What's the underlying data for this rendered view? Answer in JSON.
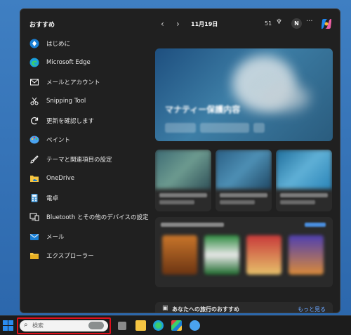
{
  "start_panel": {
    "recommended_title": "おすすめ",
    "items": [
      {
        "label": "はじめに",
        "icon": "tips-icon",
        "color": "#1a7fd4"
      },
      {
        "label": "Microsoft Edge",
        "icon": "edge-icon",
        "color": "#1aa0e0"
      },
      {
        "label": "メールとアカウント",
        "icon": "mail-account-icon",
        "color": "#ffffff"
      },
      {
        "label": "Snipping Tool",
        "icon": "snipping-tool-icon",
        "color": "#ffffff"
      },
      {
        "label": "更新を確認します",
        "icon": "refresh-icon",
        "color": "#ffffff"
      },
      {
        "label": "ペイント",
        "icon": "paint-icon",
        "color": "#4aa3f0"
      },
      {
        "label": "テーマと関連項目の設定",
        "icon": "brush-icon",
        "color": "#ffffff"
      },
      {
        "label": "OneDrive",
        "icon": "folder-onedrive-icon",
        "color": "#f5c542"
      },
      {
        "label": "電卓",
        "icon": "calculator-icon",
        "color": "#4a9bd8"
      },
      {
        "label": "Bluetooth とその他のデバイスの設定",
        "icon": "devices-icon",
        "color": "#ffffff"
      },
      {
        "label": "メール",
        "icon": "mail-icon",
        "color": "#1a7fd4"
      },
      {
        "label": "エクスプローラー",
        "icon": "file-explorer-icon",
        "color": "#f5c542"
      }
    ]
  },
  "feed": {
    "date": "11月19日",
    "temperature": "51",
    "avatar_initial": "N",
    "more_label": "···",
    "hero_title": "マナティー保護内容",
    "trip_title": "あなたへの旅行のおすすめ",
    "trip_more": "もっと見る"
  },
  "taskbar": {
    "search_placeholder": "検索"
  }
}
